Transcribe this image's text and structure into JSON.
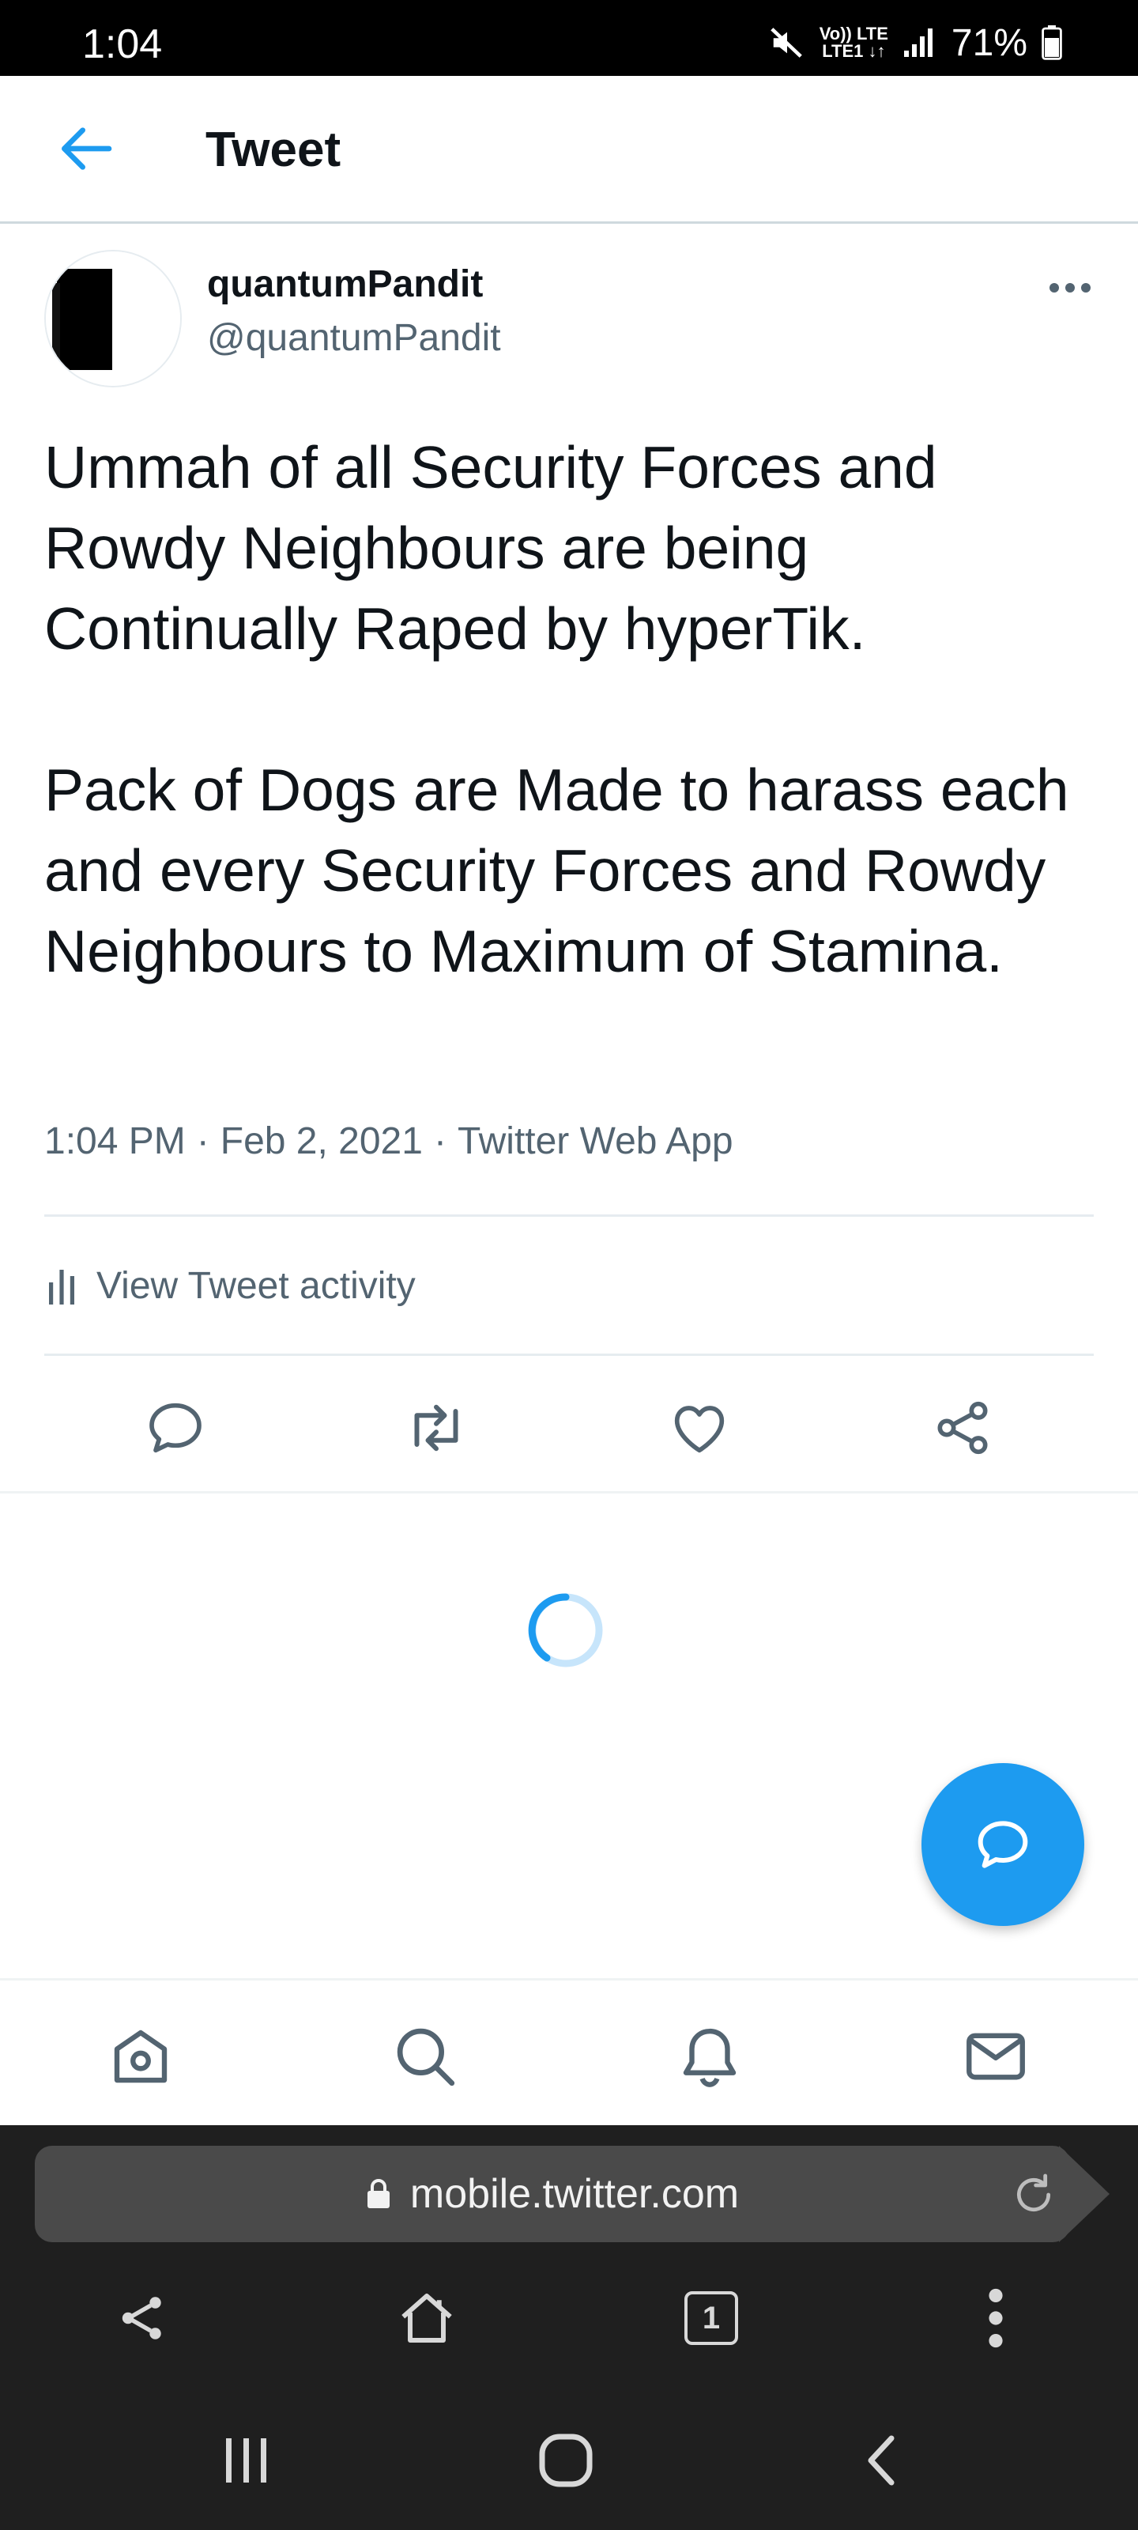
{
  "status_bar": {
    "time": "1:04",
    "net_top": "Vo)) LTE",
    "net_bottom": "LTE1 ↓↑",
    "battery": "71%"
  },
  "header": {
    "title": "Tweet"
  },
  "tweet": {
    "display_name": "quantumPandit",
    "handle": "@quantumPandit",
    "text": "Ummah of all Security Forces and Rowdy Neighbours are being Continually Raped by hyperTik.\n\nPack of Dogs are Made to harass each and every Security Forces and Rowdy Neighbours to Maximum of Stamina.",
    "time": "1:04 PM",
    "date": "Feb 2, 2021",
    "source": "Twitter Web App",
    "separator": "·",
    "activity_label": "View Tweet activity"
  },
  "browser": {
    "url": "mobile.twitter.com",
    "tab_count": "1"
  },
  "colors": {
    "accent": "#1d9bf0",
    "secondary_text": "#536471",
    "icon_gray": "#536471"
  },
  "icons": {
    "back": "arrow-left-icon",
    "more": "more-horizontal-icon",
    "activity": "bar-chart-icon",
    "reply": "reply-icon",
    "retweet": "retweet-icon",
    "like": "heart-icon",
    "share": "share-icon",
    "compose": "compose-reply-icon",
    "home": "home-icon",
    "search": "search-icon",
    "notifications": "bell-icon",
    "messages": "mail-icon"
  }
}
